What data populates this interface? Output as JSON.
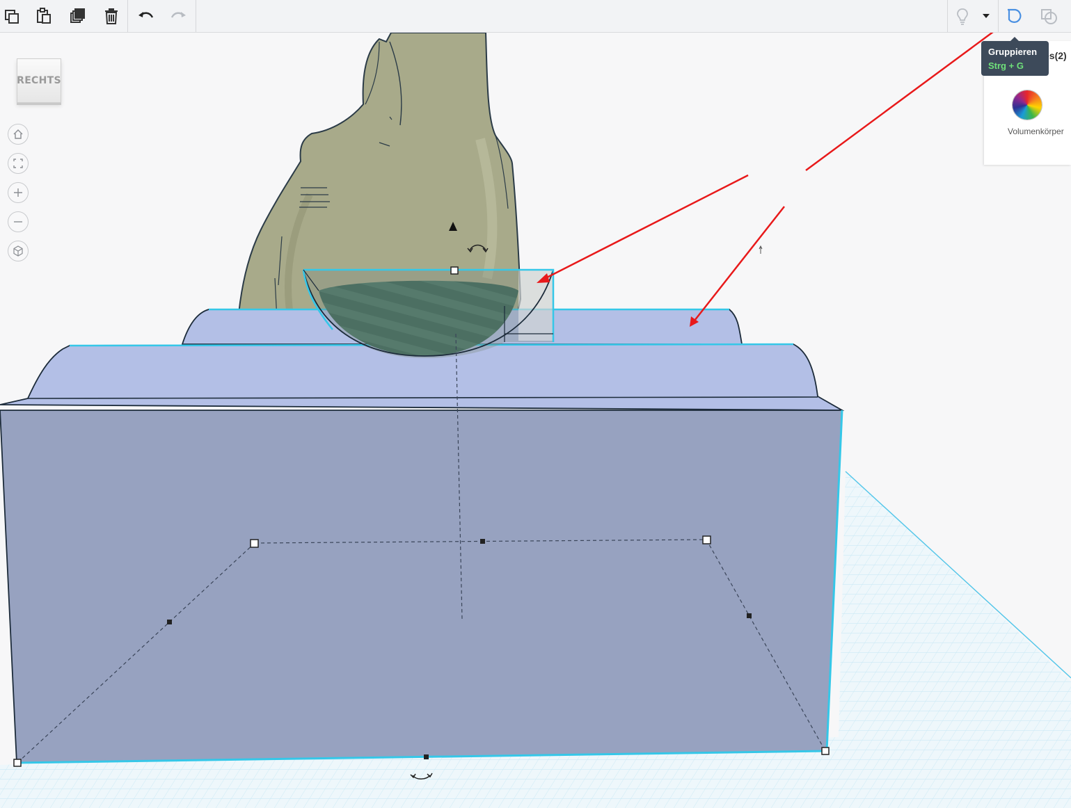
{
  "toolbar": {
    "copy_icon": "copy-icon",
    "paste_icon": "paste-icon",
    "duplicate_icon": "duplicate-icon",
    "delete_icon": "trash-icon",
    "undo_icon": "undo-icon",
    "redo_icon": "redo-icon",
    "hint_icon": "lightbulb-icon",
    "dropdown_icon": "caret-down-icon",
    "group_icon": "group-icon",
    "ungroup_icon": "ungroup-icon"
  },
  "viewcube": {
    "face_label": "RECHTS"
  },
  "nav_controls": [
    "home-icon",
    "fit-view-icon",
    "zoom-in-icon",
    "zoom-out-icon",
    "perspective-icon"
  ],
  "tooltip": {
    "title": "Gruppieren",
    "shortcut": "Strg + G"
  },
  "shapes_panel": {
    "header": "es(2)",
    "material_label": "Volumenkörper"
  },
  "colors": {
    "accent": "#4a90e2",
    "selection_outline": "#35c7e8",
    "box_front": "#97a2c0",
    "box_top": "#b3bfe6",
    "figure": "#a8aa8a",
    "hole": "#4a6e60",
    "grid": "#bfe3f1",
    "annotation_arrow": "#e8191a",
    "tooltip_bg": "#3d4a5a",
    "shortcut_text": "#6fe07a"
  }
}
